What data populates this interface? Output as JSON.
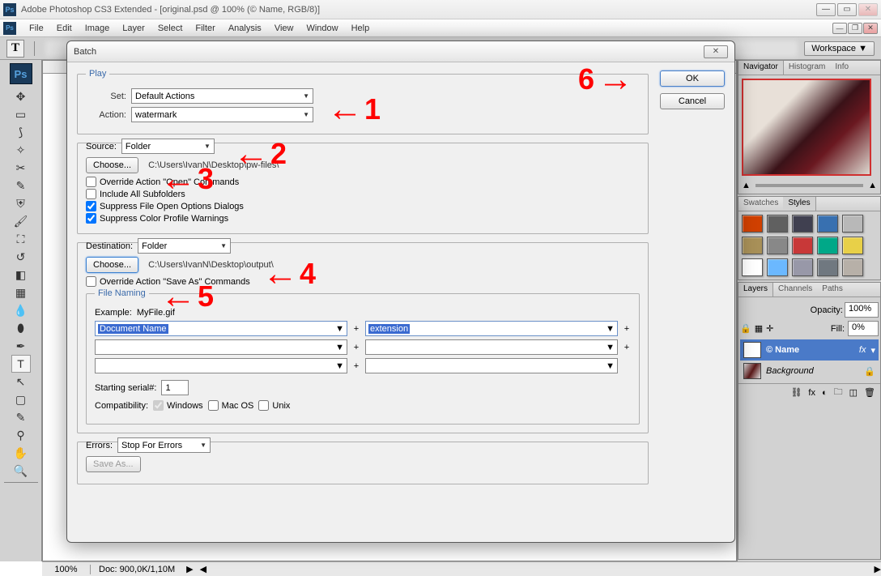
{
  "window": {
    "title": "Adobe Photoshop CS3 Extended - [original.psd @ 100% (© Name, RGB/8)]"
  },
  "menu": [
    "File",
    "Edit",
    "Image",
    "Layer",
    "Select",
    "Filter",
    "Analysis",
    "View",
    "Window",
    "Help"
  ],
  "workspace_label": "Workspace ▼",
  "status": {
    "zoom": "100%",
    "doc": "Doc: 900,0K/1,10M"
  },
  "panels": {
    "navigator_tabs": [
      "Navigator",
      "Histogram",
      "Info"
    ],
    "swatches_tabs": [
      "Swatches",
      "Styles"
    ],
    "layers_tabs": [
      "Layers",
      "Channels",
      "Paths"
    ],
    "opacity_label": "Opacity:",
    "opacity_val": "100%",
    "fill_label": "Fill:",
    "fill_val": "0%",
    "layers": [
      {
        "name": "© Name",
        "fx": "fx"
      },
      {
        "name": "Background"
      }
    ]
  },
  "dialog": {
    "title": "Batch",
    "ok": "OK",
    "cancel": "Cancel",
    "play": {
      "legend": "Play",
      "set_label": "Set:",
      "set_value": "Default Actions",
      "action_label": "Action:",
      "action_value": "watermark"
    },
    "source": {
      "label": "Source:",
      "value": "Folder",
      "choose": "Choose...",
      "path": "C:\\Users\\IvanN\\Desktop\\pw-files\\",
      "cb_override": "Override Action \"Open\" Commands",
      "cb_subfolders": "Include All Subfolders",
      "cb_suppress_open": "Suppress File Open Options Dialogs",
      "cb_suppress_color": "Suppress Color Profile Warnings"
    },
    "destination": {
      "label": "Destination:",
      "value": "Folder",
      "choose": "Choose...",
      "path": "C:\\Users\\IvanN\\Desktop\\output\\",
      "cb_override": "Override Action \"Save As\" Commands",
      "file_naming": {
        "legend": "File Naming",
        "example_label": "Example:",
        "example_value": "MyFile.gif",
        "field1": "Document Name",
        "field2": "extension",
        "serial_label": "Starting serial#:",
        "serial_value": "1",
        "compat_label": "Compatibility:",
        "compat_win": "Windows",
        "compat_mac": "Mac OS",
        "compat_unix": "Unix"
      }
    },
    "errors": {
      "label": "Errors:",
      "value": "Stop For Errors",
      "save_as": "Save As..."
    }
  },
  "annotations": {
    "n1": "1",
    "n2": "2",
    "n3": "3",
    "n4": "4",
    "n5": "5",
    "n6": "6"
  },
  "swatch_colors": [
    "#d04000",
    "#606060",
    "#404050",
    "#3870b0",
    "#b8b8b8",
    "#a89058",
    "#888888",
    "#c83838",
    "#00a888",
    "#e8d048",
    "#ffffff",
    "#6bb8ff",
    "#9898a8",
    "#707880",
    "#b7b0a8"
  ]
}
